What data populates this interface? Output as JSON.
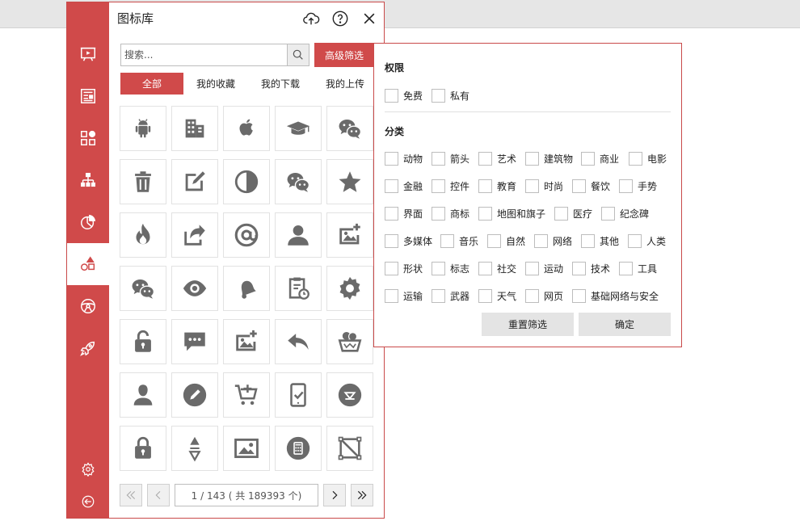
{
  "panel": {
    "title": "图标库",
    "rail": [
      {
        "icon": "presentation-icon"
      },
      {
        "icon": "article-icon"
      },
      {
        "icon": "apps-icon"
      },
      {
        "icon": "org-chart-icon"
      },
      {
        "icon": "pie-chart-icon"
      },
      {
        "icon": "shapes-icon",
        "active": true
      },
      {
        "icon": "steering-wheel-icon"
      },
      {
        "icon": "rocket-icon"
      }
    ],
    "rail_bottom": [
      {
        "icon": "settings-icon"
      },
      {
        "icon": "back-icon"
      }
    ]
  },
  "search": {
    "placeholder": "搜索...",
    "value": ""
  },
  "advanced_filter_label": "高级筛选",
  "tabs": [
    {
      "label": "全部",
      "active": true
    },
    {
      "label": "我的收藏"
    },
    {
      "label": "我的下载"
    },
    {
      "label": "我的上传"
    }
  ],
  "icons": [
    "android-icon",
    "building-icon",
    "apple-icon",
    "graduation-cap-icon",
    "wechat-icon",
    "trash-icon",
    "edit-icon",
    "contrast-icon",
    "wechat-icon",
    "star-icon",
    "fire-icon",
    "share-icon",
    "at-icon",
    "user-icon",
    "add-image-icon",
    "wechat-icon",
    "eye-icon",
    "bell-icon",
    "clipboard-clock-icon",
    "gear-icon",
    "unlock-icon",
    "chat-icon",
    "add-image-icon",
    "reply-icon",
    "basket-icon",
    "user-silhouette-icon",
    "pencil-circle-icon",
    "add-cart-icon",
    "tablet-check-icon",
    "triangle-circle-icon",
    "lock-icon",
    "sort-icon",
    "image-icon",
    "calculator-icon",
    "crop-icon"
  ],
  "pagination": {
    "current": "1",
    "text": "1 / 143 ( 共 189393 个)"
  },
  "filter": {
    "permission_title": "权限",
    "permissions": [
      "免费",
      "私有"
    ],
    "category_title": "分类",
    "categories": [
      [
        "动物",
        "箭头",
        "艺术",
        "建筑物",
        "商业",
        "电影"
      ],
      [
        "金融",
        "控件",
        "教育",
        "时尚",
        "餐饮",
        "手势"
      ],
      [
        "界面",
        "商标",
        "地图和旗子",
        "医疗",
        "纪念碑"
      ],
      [
        "多媒体",
        "音乐",
        "自然",
        "网络",
        "其他",
        "人类"
      ],
      [
        "形状",
        "标志",
        "社交",
        "运动",
        "技术",
        "工具"
      ],
      [
        "运输",
        "武器",
        "天气",
        "网页",
        "基础网络与安全"
      ]
    ],
    "reset_label": "重置筛选",
    "confirm_label": "确定"
  },
  "colors": {
    "accent": "#d04a4a",
    "icon": "#6a6a6a"
  }
}
